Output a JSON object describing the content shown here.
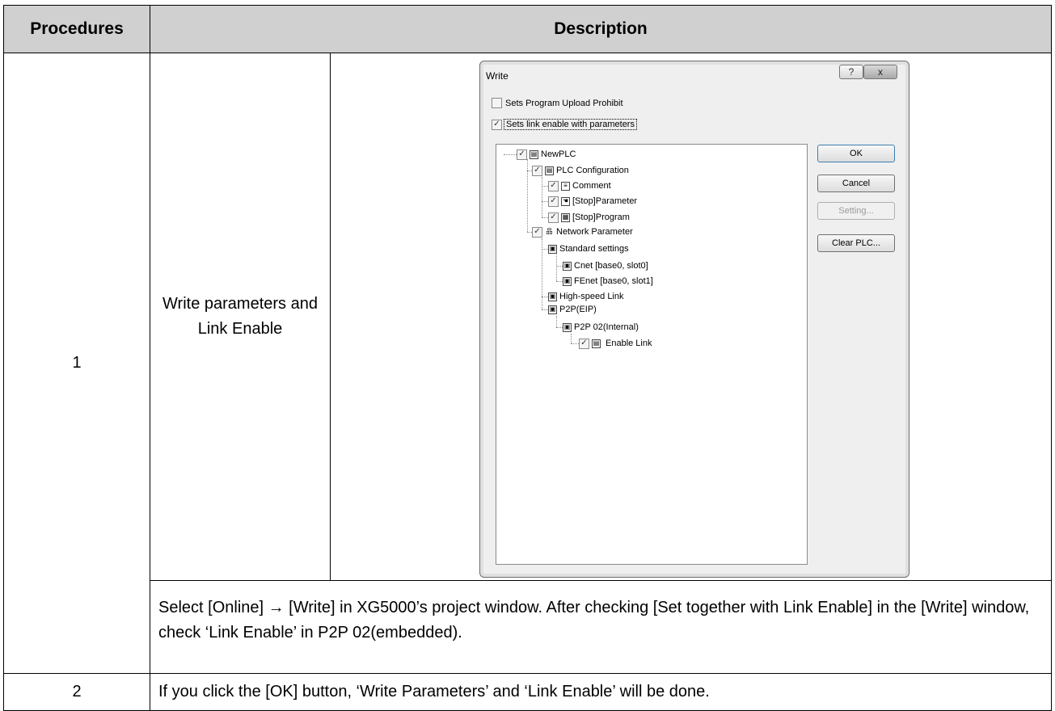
{
  "table": {
    "headers": {
      "procedures": "Procedures",
      "description": "Description"
    },
    "row1": {
      "number": "1",
      "title": "Write parameters and Link Enable",
      "description": "Select [Online] → [Write] in XG5000’s project window. After checking [Set together with Link Enable] in the [Write] window, check ‘Link Enable’ in P2P 02(embedded)."
    },
    "row2": {
      "number": "2",
      "description": "If you click the [OK] button, ‘Write Parameters’ and ‘Link Enable’    will be done."
    }
  },
  "dialog": {
    "title": "Write",
    "help_label": "?",
    "close_label": "x",
    "options": [
      {
        "label": "Sets Program Upload Prohibit",
        "checked": false
      },
      {
        "label": "Sets link enable with parameters",
        "checked": true
      }
    ],
    "buttons": {
      "ok": "OK",
      "cancel": "Cancel",
      "setting": "Setting...",
      "clear": "Clear PLC..."
    },
    "tree": [
      {
        "label": "NewPLC",
        "checked": true
      },
      {
        "label": "PLC Configuration",
        "checked": true
      },
      {
        "label": "Comment",
        "checked": true
      },
      {
        "label": "[Stop]Parameter",
        "checked": true
      },
      {
        "label": "[Stop]Program",
        "checked": true
      },
      {
        "label": "Network Parameter",
        "checked": true
      },
      {
        "label": "Standard settings"
      },
      {
        "label": "Cnet [base0, slot0]"
      },
      {
        "label": "FEnet [base0, slot1]"
      },
      {
        "label": "High-speed Link"
      },
      {
        "label": "P2P(EIP)"
      },
      {
        "label": "P2P 02(Internal)"
      },
      {
        "label": "Enable Link",
        "checked": true
      }
    ]
  }
}
